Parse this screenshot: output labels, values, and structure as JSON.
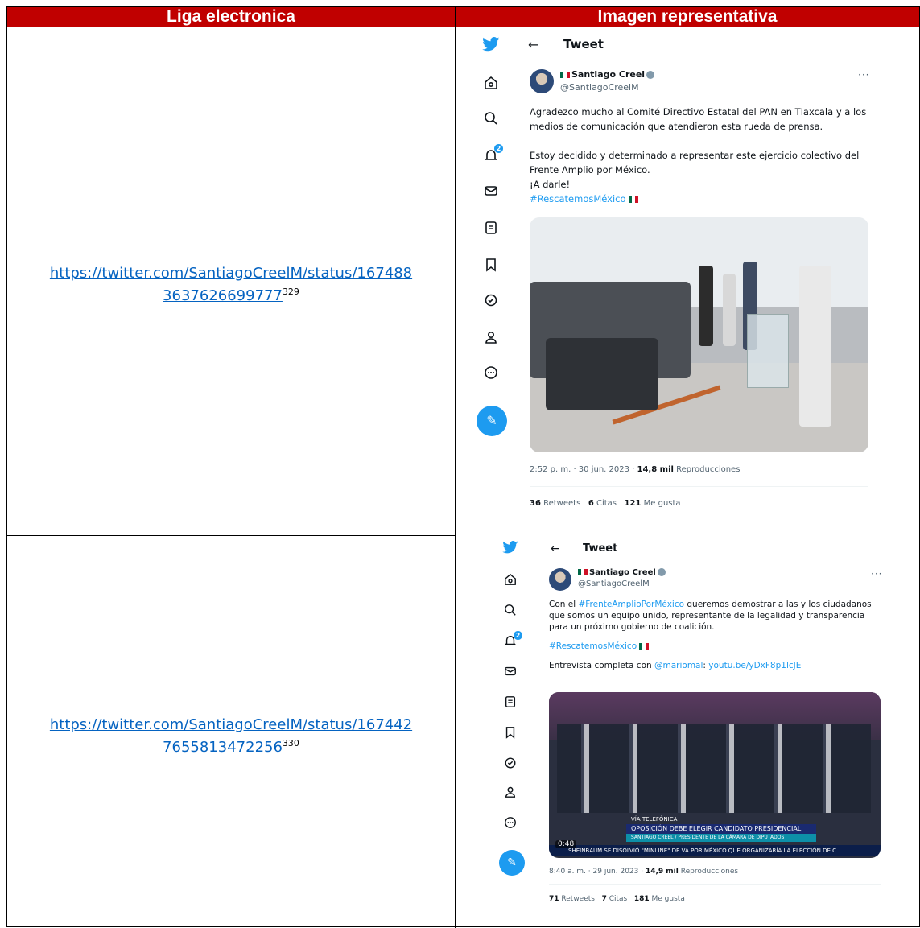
{
  "table": {
    "header_link": "Liga electronica",
    "header_image": "Imagen representativa"
  },
  "rows": [
    {
      "link_line1": "https://twitter.com/SantiagoCreelM/status/167488",
      "link_line2": "3637626699777",
      "footnote": "329",
      "tweet": {
        "title": "Tweet",
        "name": "Santiago Creel",
        "handle": "@SantiagoCreelM",
        "more": "···",
        "text_p1": "Agradezco mucho al Comité Directivo Estatal del PAN en Tlaxcala y a los medios de comunicación que atendieron esta rueda de prensa.",
        "text_p2": "Estoy decidido y determinado a representar este ejercicio colectivo del Frente Amplio por México.",
        "text_p3": "¡A darle!",
        "hashtag": "#RescatemosMéxico",
        "time": "2:52 p. m. · 30 jun. 2023 · ",
        "views_count": "14,8 mil",
        "views_label": "Reproducciones",
        "retweets_count": "36",
        "retweets_label": "Retweets",
        "quotes_count": "6",
        "quotes_label": "Citas",
        "likes_count": "121",
        "likes_label": "Me gusta",
        "notif_badge": "2"
      }
    },
    {
      "link_line1": "https://twitter.com/SantiagoCreelM/status/167442",
      "link_line2": "7655813472256",
      "footnote": "330",
      "tweet": {
        "title": "Tweet",
        "name": "Santiago Creel",
        "handle": "@SantiagoCreelM",
        "more": "···",
        "text_p1a": "Con el ",
        "text_p1_hash": "#FrenteAmplioPorMéxico",
        "text_p1b": " queremos demostrar a las y los ciudadanos que somos un equipo unido, representante de la legalidad y transparencia para un próximo gobierno de coalición.",
        "hashtag": "#RescatemosMéxico",
        "interview_prefix": "Entrevista completa con ",
        "interview_mention": "@mariomal",
        "interview_sep": ": ",
        "interview_link": "youtu.be/yDxF8p1lcJE",
        "video_banner_top": "VÍA TELEFÓNICA",
        "video_banner_main": "OPOSICIÓN DEBE ELEGIR CANDIDATO PRESIDENCIAL",
        "video_banner_sub": "SANTIAGO CREEL / PRESIDENTE DE LA CÁMARA DE DIPUTADOS",
        "video_ticker": "SHEINBAUM   SE DISOLVIÓ \"MINI INE\" DE VA POR MÉXICO QUE ORGANIZARÍA LA ELECCIÓN DE C",
        "video_time": "0:48",
        "time": "8:40 a. m. · 29 jun. 2023 · ",
        "views_count": "14,9 mil",
        "views_label": "Reproducciones",
        "retweets_count": "71",
        "retweets_label": "Retweets",
        "quotes_count": "7",
        "quotes_label": "Citas",
        "likes_count": "181",
        "likes_label": "Me gusta",
        "notif_badge": "2"
      }
    }
  ],
  "icons": [
    "twitter-bird-icon",
    "home-icon",
    "search-icon",
    "notifications-icon",
    "messages-icon",
    "lists-icon",
    "bookmarks-icon",
    "verified-orgs-icon",
    "profile-icon",
    "more-icon",
    "compose-icon"
  ],
  "colors": {
    "header_bg": "#c00000",
    "link": "#0563c1",
    "twitter_blue": "#1d9bf0"
  }
}
